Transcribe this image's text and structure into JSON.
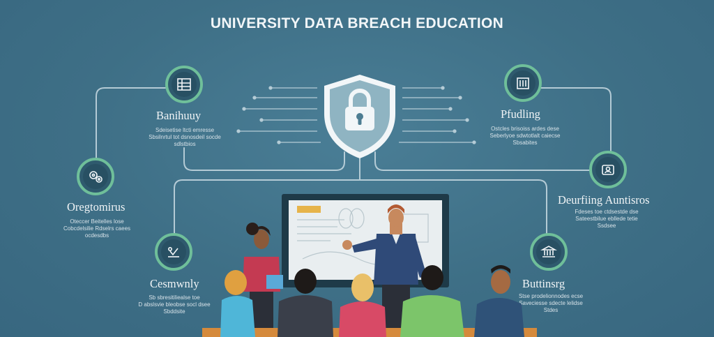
{
  "title": "UNIVERSITY DATA BREACH EDUCATION",
  "colors": {
    "background": "#3e6f86",
    "node_ring": "#6fbf9a",
    "shield": "#8fb4c2",
    "line": "#c9dbe3"
  },
  "nodes": [
    {
      "label": "Banihuuy",
      "desc": "Sdeisetise ltcti emresse\nSbsilnrtul tot dsnosdeil socde\nsdlstbios",
      "icon": "server-rack-icon"
    },
    {
      "label": "Pfudling",
      "desc": "Ostcles brisoiss ardes dese\nSeberlyoe sdwtotlalt caiecse\nSbsabites",
      "icon": "building-icon"
    },
    {
      "label": "Oregtomirus",
      "desc": "Oteccer Beitelles lose\nCobcdelsilie Rdselrs caees\nocdesdbs",
      "icon": "gears-icon"
    },
    {
      "label": "Deurfiing Auntisros",
      "desc": "Fdeses toe ctdsestde dse\nSateestbilue ebllede tetie\nSsdsee",
      "icon": "identity-icon"
    },
    {
      "label": "Cesmwnly",
      "desc": "Sb sbresitiliealse toe\nD abslsvie bleobse socl dsee\nSbddsite",
      "icon": "community-icon"
    },
    {
      "label": "Buttinsrg",
      "desc": "Stse prodelionnodes ecse\nSaveciesse sdecte lelidse\nStdes",
      "icon": "institution-icon"
    }
  ],
  "center": {
    "icon": "padlock-shield-icon"
  },
  "presentation": {
    "board": "whiteboard",
    "presenter": "presenter",
    "audience_count": 7
  }
}
